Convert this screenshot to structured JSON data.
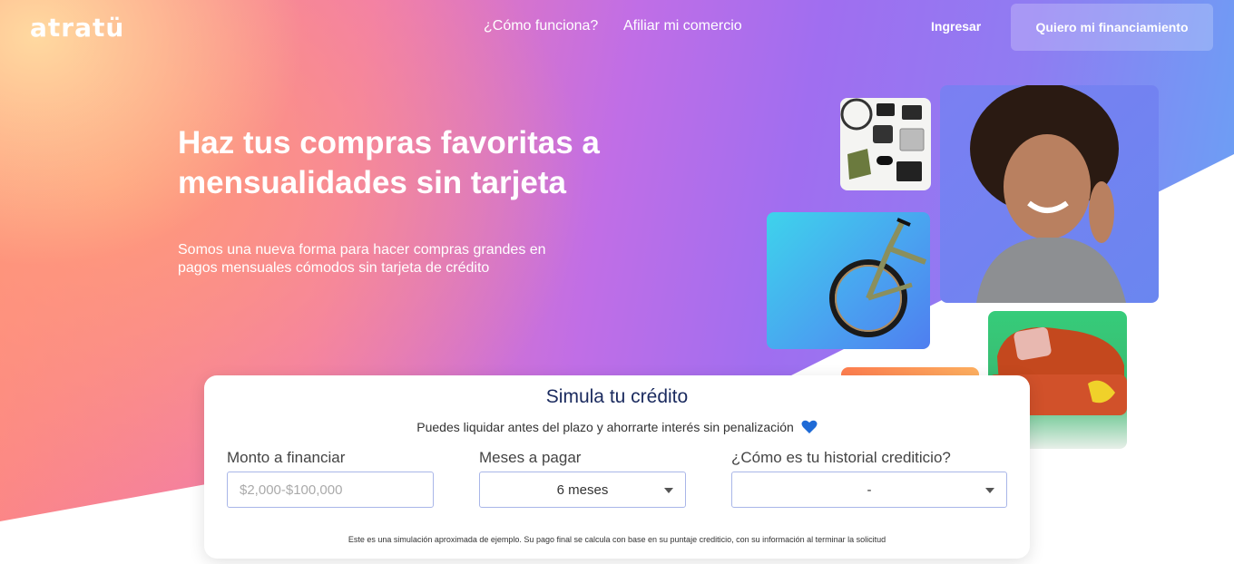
{
  "nav": {
    "logo": "atratü",
    "links": [
      "¿Cómo funciona?",
      "Afiliar mi comercio"
    ],
    "login": "Ingresar",
    "cta": "Quiero mi financiamiento"
  },
  "hero": {
    "headline": "Haz tus compras favoritas a mensualidades sin tarjeta",
    "subtitle": "Somos una nueva forma para hacer compras grandes en pagos mensuales cómodos sin tarjeta de crédito"
  },
  "simulator": {
    "title": "Simula tu crédito",
    "note": "Puedes liquidar antes del plazo y ahorrarte interés sin penalización",
    "amount_label": "Monto a financiar",
    "amount_placeholder": "$2,000-$100,000",
    "months_label": "Meses a pagar",
    "months_value": "6 meses",
    "history_label": "¿Cómo es tu historial crediticio?",
    "history_value": "-",
    "disclaimer": "Este es una simulación aproximada de ejemplo. Su pago final se calcula con base en su puntaje crediticio, con su información al terminar la solicitud"
  },
  "colors": {
    "title": "#1a2a5e",
    "field_border": "#a9b6e8",
    "heart": "#1e6ad6"
  },
  "images": {
    "gadgets": "gadgets-flatlay-image",
    "woman": "smiling-woman-image",
    "bike": "bicycle-image",
    "sofa": "orange-sofa-image"
  }
}
